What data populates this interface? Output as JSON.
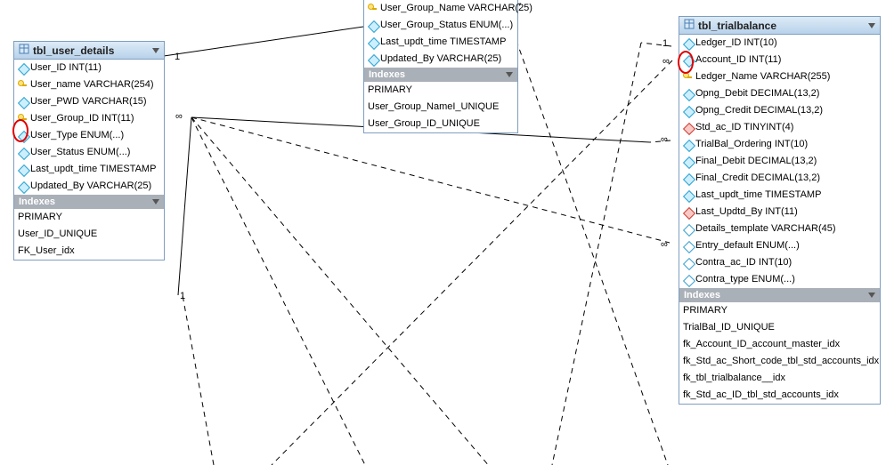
{
  "tables": {
    "user_details": {
      "title": "tbl_user_details",
      "columns": [
        {
          "icon": "blue",
          "text": "User_ID INT(11)"
        },
        {
          "icon": "key",
          "text": "User_name VARCHAR(254)"
        },
        {
          "icon": "blue",
          "text": "User_PWD VARCHAR(15)"
        },
        {
          "icon": "key",
          "text": "User_Group_ID INT(11)"
        },
        {
          "icon": "blue",
          "text": "User_Type ENUM(...)"
        },
        {
          "icon": "blue",
          "text": "User_Status ENUM(...)"
        },
        {
          "icon": "blue",
          "text": "Last_updt_time TIMESTAMP"
        },
        {
          "icon": "blue",
          "text": "Updated_By VARCHAR(25)"
        }
      ],
      "indexes_label": "Indexes",
      "indexes": [
        "PRIMARY",
        "User_ID_UNIQUE",
        "FK_User_idx"
      ]
    },
    "user_group": {
      "columns": [
        {
          "icon": "key",
          "text": "User_Group_Name VARCHAR(25)"
        },
        {
          "icon": "blue",
          "text": "User_Group_Status ENUM(...)"
        },
        {
          "icon": "blue",
          "text": "Last_updt_time TIMESTAMP"
        },
        {
          "icon": "blue",
          "text": "Updated_By VARCHAR(25)"
        }
      ],
      "indexes_label": "Indexes",
      "indexes": [
        "PRIMARY",
        "User_Group_NameI_UNIQUE",
        "User_Group_ID_UNIQUE"
      ]
    },
    "trialbalance": {
      "title": "tbl_trialbalance",
      "columns": [
        {
          "icon": "blue",
          "text": "Ledger_ID INT(10)"
        },
        {
          "icon": "blue",
          "text": "Account_ID INT(11)"
        },
        {
          "icon": "key",
          "text": "Ledger_Name VARCHAR(255)"
        },
        {
          "icon": "blue",
          "text": "Opng_Debit DECIMAL(13,2)"
        },
        {
          "icon": "blue",
          "text": "Opng_Credit DECIMAL(13,2)"
        },
        {
          "icon": "red",
          "text": "Std_ac_ID TINYINT(4)"
        },
        {
          "icon": "blue",
          "text": "TrialBal_Ordering INT(10)"
        },
        {
          "icon": "blue",
          "text": "Final_Debit DECIMAL(13,2)"
        },
        {
          "icon": "blue",
          "text": "Final_Credit DECIMAL(13,2)"
        },
        {
          "icon": "blue",
          "text": "Last_updt_time TIMESTAMP"
        },
        {
          "icon": "red",
          "text": "Last_Updtd_By INT(11)"
        },
        {
          "icon": "open",
          "text": "Details_template VARCHAR(45)"
        },
        {
          "icon": "open",
          "text": "Entry_default ENUM(...)"
        },
        {
          "icon": "open",
          "text": "Contra_ac_ID INT(10)"
        },
        {
          "icon": "open",
          "text": "Contra_type ENUM(...)"
        }
      ],
      "indexes_label": "Indexes",
      "indexes": [
        "PRIMARY",
        "TrialBal_ID_UNIQUE",
        "fk_Account_ID_account_master_idx",
        "fk_Std_ac_Short_code_tbl_std_accounts_idx",
        "fk_tbl_trialbalance__idx",
        "fk_Std_ac_ID_tbl_std_accounts_idx"
      ]
    }
  },
  "cardinality": {
    "one": "1",
    "many": "∞"
  }
}
